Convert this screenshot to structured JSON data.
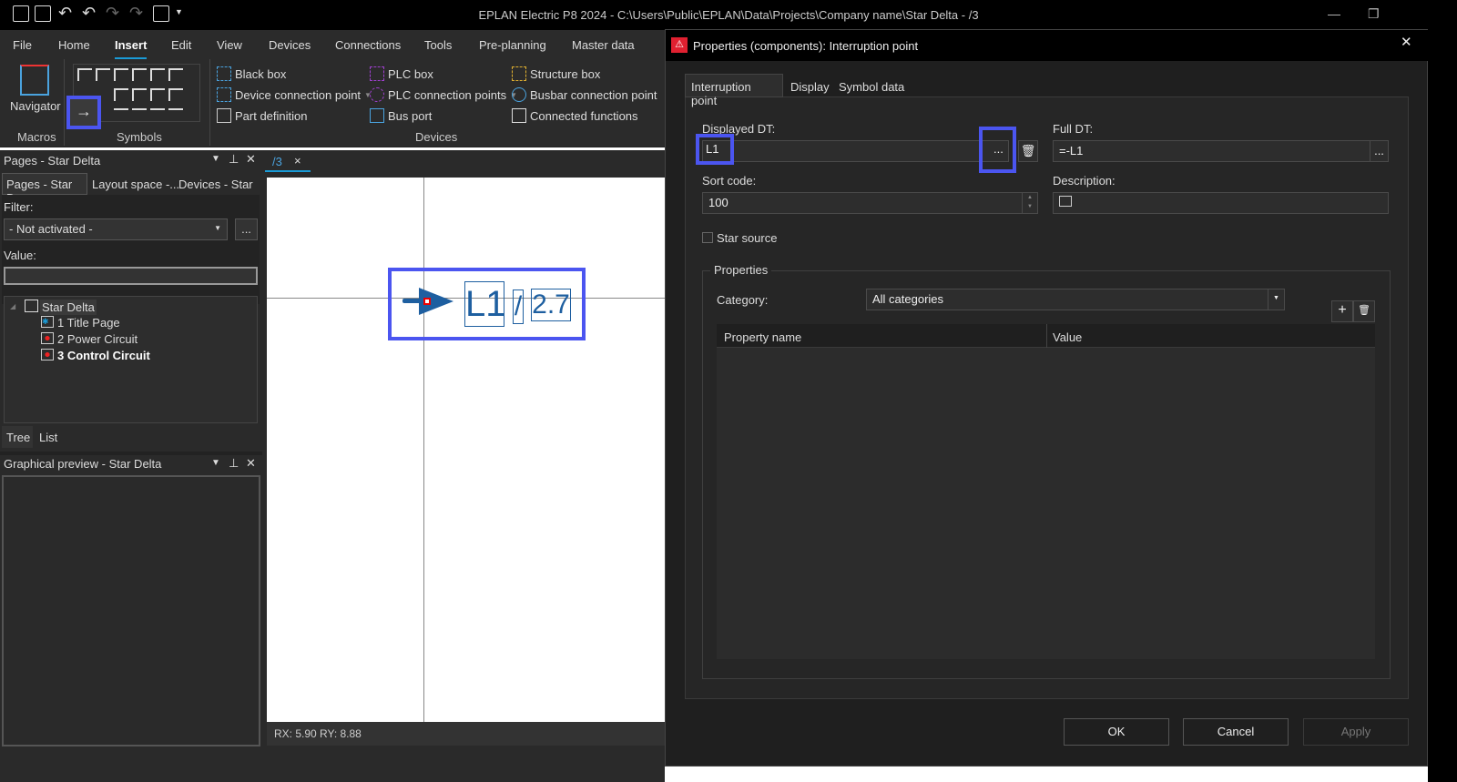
{
  "titlebar": {
    "title": "EPLAN Electric P8 2024 - C:\\Users\\Public\\EPLAN\\Data\\Projects\\Company name\\Star Delta - /3"
  },
  "ribbon_tabs": [
    "File",
    "Home",
    "Insert",
    "Edit",
    "View",
    "Devices",
    "Connections",
    "Tools",
    "Pre-planning",
    "Master data"
  ],
  "ribbon": {
    "navigator": "Navigator",
    "groups": {
      "macros": "Macros",
      "symbols": "Symbols",
      "devices": "Devices"
    },
    "devices": [
      "Black box",
      "Device connection point",
      "Part definition",
      "PLC box",
      "PLC connection points",
      "Bus port",
      "Structure box",
      "Busbar connection point",
      "Connected functions"
    ]
  },
  "pages_panel": {
    "title": "Pages - Star Delta",
    "tabs": [
      "Pages - Star D...",
      "Layout space -...",
      "Devices - Star ..."
    ],
    "filter_label": "Filter:",
    "filter_value": "- Not activated -",
    "more": "...",
    "value_label": "Value:",
    "value": "",
    "tree": {
      "root": "Star Delta",
      "pages": [
        "1 Title Page",
        "2 Power Circuit",
        "3 Control Circuit"
      ]
    },
    "bottom_tabs": [
      "Tree",
      "List"
    ]
  },
  "preview_panel": {
    "title": "Graphical preview - Star Delta"
  },
  "editor": {
    "tab": "/3",
    "close": "×",
    "symbol_dt": "L1",
    "symbol_sep": "/",
    "symbol_ref": "2.7",
    "status": "RX: 5.90 RY: 8.88"
  },
  "dialog": {
    "title": "Properties (components): Interruption point",
    "close": "✕",
    "tabs": [
      "Interruption point",
      "Display",
      "Symbol data"
    ],
    "displayed_dt_label": "Displayed DT:",
    "displayed_dt": "L1",
    "more": "...",
    "full_dt_label": "Full DT:",
    "full_dt": "=-L1",
    "sort_code_label": "Sort code:",
    "sort_code": "100",
    "description_label": "Description:",
    "description": "",
    "star_source": "Star source",
    "star_source_checked": false,
    "properties_group": "Properties",
    "category_label": "Category:",
    "category": "All categories",
    "columns": [
      "Property name",
      "Value"
    ],
    "ok": "OK",
    "cancel": "Cancel",
    "apply": "Apply"
  },
  "colors": {
    "accent": "#1a9bd7",
    "highlight": "#4b55f0",
    "symbol": "#1e5fa0"
  }
}
